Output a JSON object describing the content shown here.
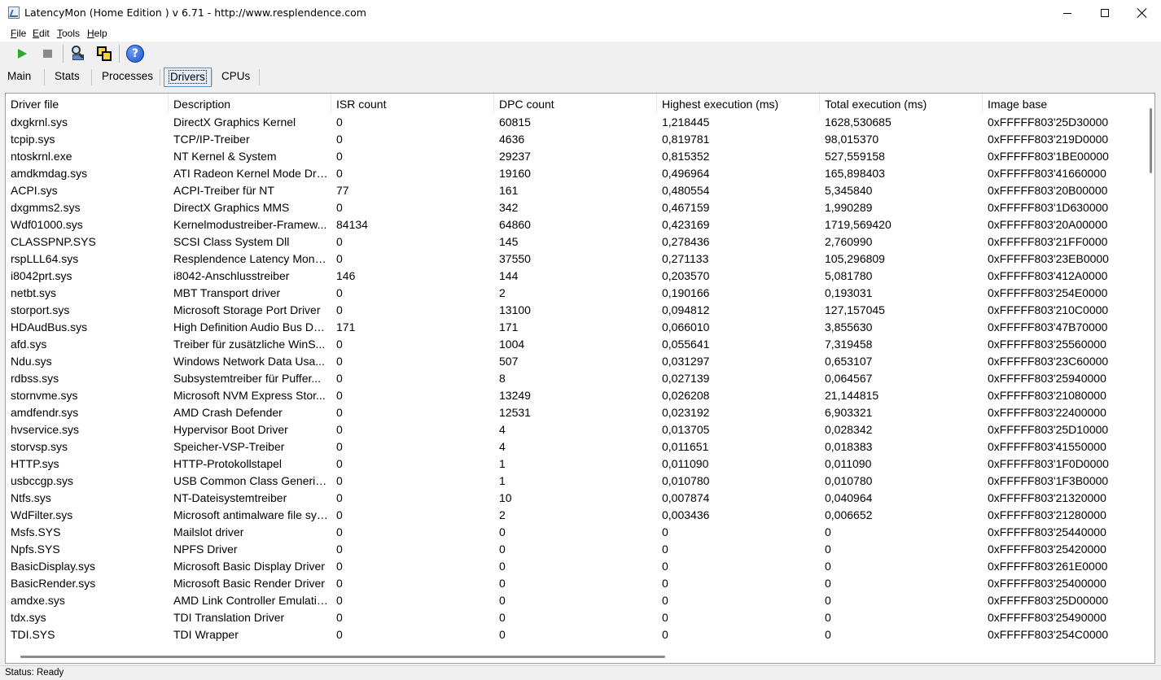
{
  "window": {
    "title": "LatencyMon  (Home Edition )  v 6.71 - http://www.resplendence.com"
  },
  "menu": [
    {
      "pre": "",
      "u": "F",
      "post": "ile"
    },
    {
      "pre": "",
      "u": "E",
      "post": "dit"
    },
    {
      "pre": "",
      "u": "T",
      "post": "ools"
    },
    {
      "pre": "",
      "u": "H",
      "post": "elp"
    }
  ],
  "toolbar": {
    "icons": [
      "play-icon",
      "stop-icon",
      "find-driver-icon",
      "windows-icon",
      "help-icon"
    ],
    "help_glyph": "?"
  },
  "tabs": [
    "Main",
    "Stats",
    "Processes",
    "Drivers",
    "CPUs"
  ],
  "active_tab": "Drivers",
  "table": {
    "columns": [
      "Driver file",
      "Description",
      "ISR count",
      "DPC count",
      "Highest execution (ms)",
      "Total execution (ms)",
      "Image base"
    ],
    "rows": [
      [
        "dxgkrnl.sys",
        "DirectX Graphics Kernel",
        "0",
        "60815",
        "1,218445",
        "1628,530685",
        "0xFFFFF803'25D30000"
      ],
      [
        "tcpip.sys",
        "TCP/IP-Treiber",
        "0",
        "4636",
        "0,819781",
        "98,015370",
        "0xFFFFF803'219D0000"
      ],
      [
        "ntoskrnl.exe",
        "NT Kernel & System",
        "0",
        "29237",
        "0,815352",
        "527,559158",
        "0xFFFFF803'1BE00000"
      ],
      [
        "amdkmdag.sys",
        "ATI Radeon Kernel Mode Dri...",
        "0",
        "19160",
        "0,496964",
        "165,898403",
        "0xFFFFF803'41660000"
      ],
      [
        "ACPI.sys",
        "ACPI-Treiber für NT",
        "77",
        "161",
        "0,480554",
        "5,345840",
        "0xFFFFF803'20B00000"
      ],
      [
        "dxgmms2.sys",
        "DirectX Graphics MMS",
        "0",
        "342",
        "0,467159",
        "1,990289",
        "0xFFFFF803'1D630000"
      ],
      [
        "Wdf01000.sys",
        "Kernelmodustreiber-Framew...",
        "84134",
        "64860",
        "0,423169",
        "1719,569420",
        "0xFFFFF803'20A00000"
      ],
      [
        "CLASSPNP.SYS",
        "SCSI Class System Dll",
        "0",
        "145",
        "0,278436",
        "2,760990",
        "0xFFFFF803'21FF0000"
      ],
      [
        "rspLLL64.sys",
        "Resplendence Latency Monit...",
        "0",
        "37550",
        "0,271133",
        "105,296809",
        "0xFFFFF803'23EB0000"
      ],
      [
        "i8042prt.sys",
        "i8042-Anschlusstreiber",
        "146",
        "144",
        "0,203570",
        "5,081780",
        "0xFFFFF803'412A0000"
      ],
      [
        "netbt.sys",
        "MBT Transport driver",
        "0",
        "2",
        "0,190166",
        "0,193031",
        "0xFFFFF803'254E0000"
      ],
      [
        "storport.sys",
        "Microsoft Storage Port Driver",
        "0",
        "13100",
        "0,094812",
        "127,157045",
        "0xFFFFF803'210C0000"
      ],
      [
        "HDAudBus.sys",
        "High Definition Audio Bus Dri...",
        "171",
        "171",
        "0,066010",
        "3,855630",
        "0xFFFFF803'47B70000"
      ],
      [
        "afd.sys",
        "Treiber für zusätzliche WinS...",
        "0",
        "1004",
        "0,055641",
        "7,319458",
        "0xFFFFF803'25560000"
      ],
      [
        "Ndu.sys",
        "Windows Network Data Usa...",
        "0",
        "507",
        "0,031297",
        "0,653107",
        "0xFFFFF803'23C60000"
      ],
      [
        "rdbss.sys",
        "Subsystemtreiber für Puffer...",
        "0",
        "8",
        "0,027139",
        "0,064567",
        "0xFFFFF803'25940000"
      ],
      [
        "stornvme.sys",
        "Microsoft NVM Express Stor...",
        "0",
        "13249",
        "0,026208",
        "21,144815",
        "0xFFFFF803'21080000"
      ],
      [
        "amdfendr.sys",
        "AMD Crash Defender",
        "0",
        "12531",
        "0,023192",
        "6,903321",
        "0xFFFFF803'22400000"
      ],
      [
        "hvservice.sys",
        "Hypervisor Boot Driver",
        "0",
        "4",
        "0,013705",
        "0,028342",
        "0xFFFFF803'25D10000"
      ],
      [
        "storvsp.sys",
        "Speicher-VSP-Treiber",
        "0",
        "4",
        "0,011651",
        "0,018383",
        "0xFFFFF803'41550000"
      ],
      [
        "HTTP.sys",
        "HTTP-Protokollstapel",
        "0",
        "1",
        "0,011090",
        "0,011090",
        "0xFFFFF803'1F0D0000"
      ],
      [
        "usbccgp.sys",
        "USB Common Class Generic ...",
        "0",
        "1",
        "0,010780",
        "0,010780",
        "0xFFFFF803'1F3B0000"
      ],
      [
        "Ntfs.sys",
        "NT-Dateisystemtreiber",
        "0",
        "10",
        "0,007874",
        "0,040964",
        "0xFFFFF803'21320000"
      ],
      [
        "WdFilter.sys",
        "Microsoft antimalware file sys...",
        "0",
        "2",
        "0,003436",
        "0,006652",
        "0xFFFFF803'21280000"
      ],
      [
        "Msfs.SYS",
        "Mailslot driver",
        "0",
        "0",
        "0",
        "0",
        "0xFFFFF803'25440000"
      ],
      [
        "Npfs.SYS",
        "NPFS Driver",
        "0",
        "0",
        "0",
        "0",
        "0xFFFFF803'25420000"
      ],
      [
        "BasicDisplay.sys",
        "Microsoft Basic Display Driver",
        "0",
        "0",
        "0",
        "0",
        "0xFFFFF803'261E0000"
      ],
      [
        "BasicRender.sys",
        "Microsoft Basic Render Driver",
        "0",
        "0",
        "0",
        "0",
        "0xFFFFF803'25400000"
      ],
      [
        "amdxe.sys",
        "AMD Link Controller Emulation",
        "0",
        "0",
        "0",
        "0",
        "0xFFFFF803'25D00000"
      ],
      [
        "tdx.sys",
        "TDI Translation Driver",
        "0",
        "0",
        "0",
        "0",
        "0xFFFFF803'25490000"
      ],
      [
        "TDI.SYS",
        "TDI Wrapper",
        "0",
        "0",
        "0",
        "0",
        "0xFFFFF803'254C0000"
      ]
    ]
  },
  "status": "Status: Ready"
}
